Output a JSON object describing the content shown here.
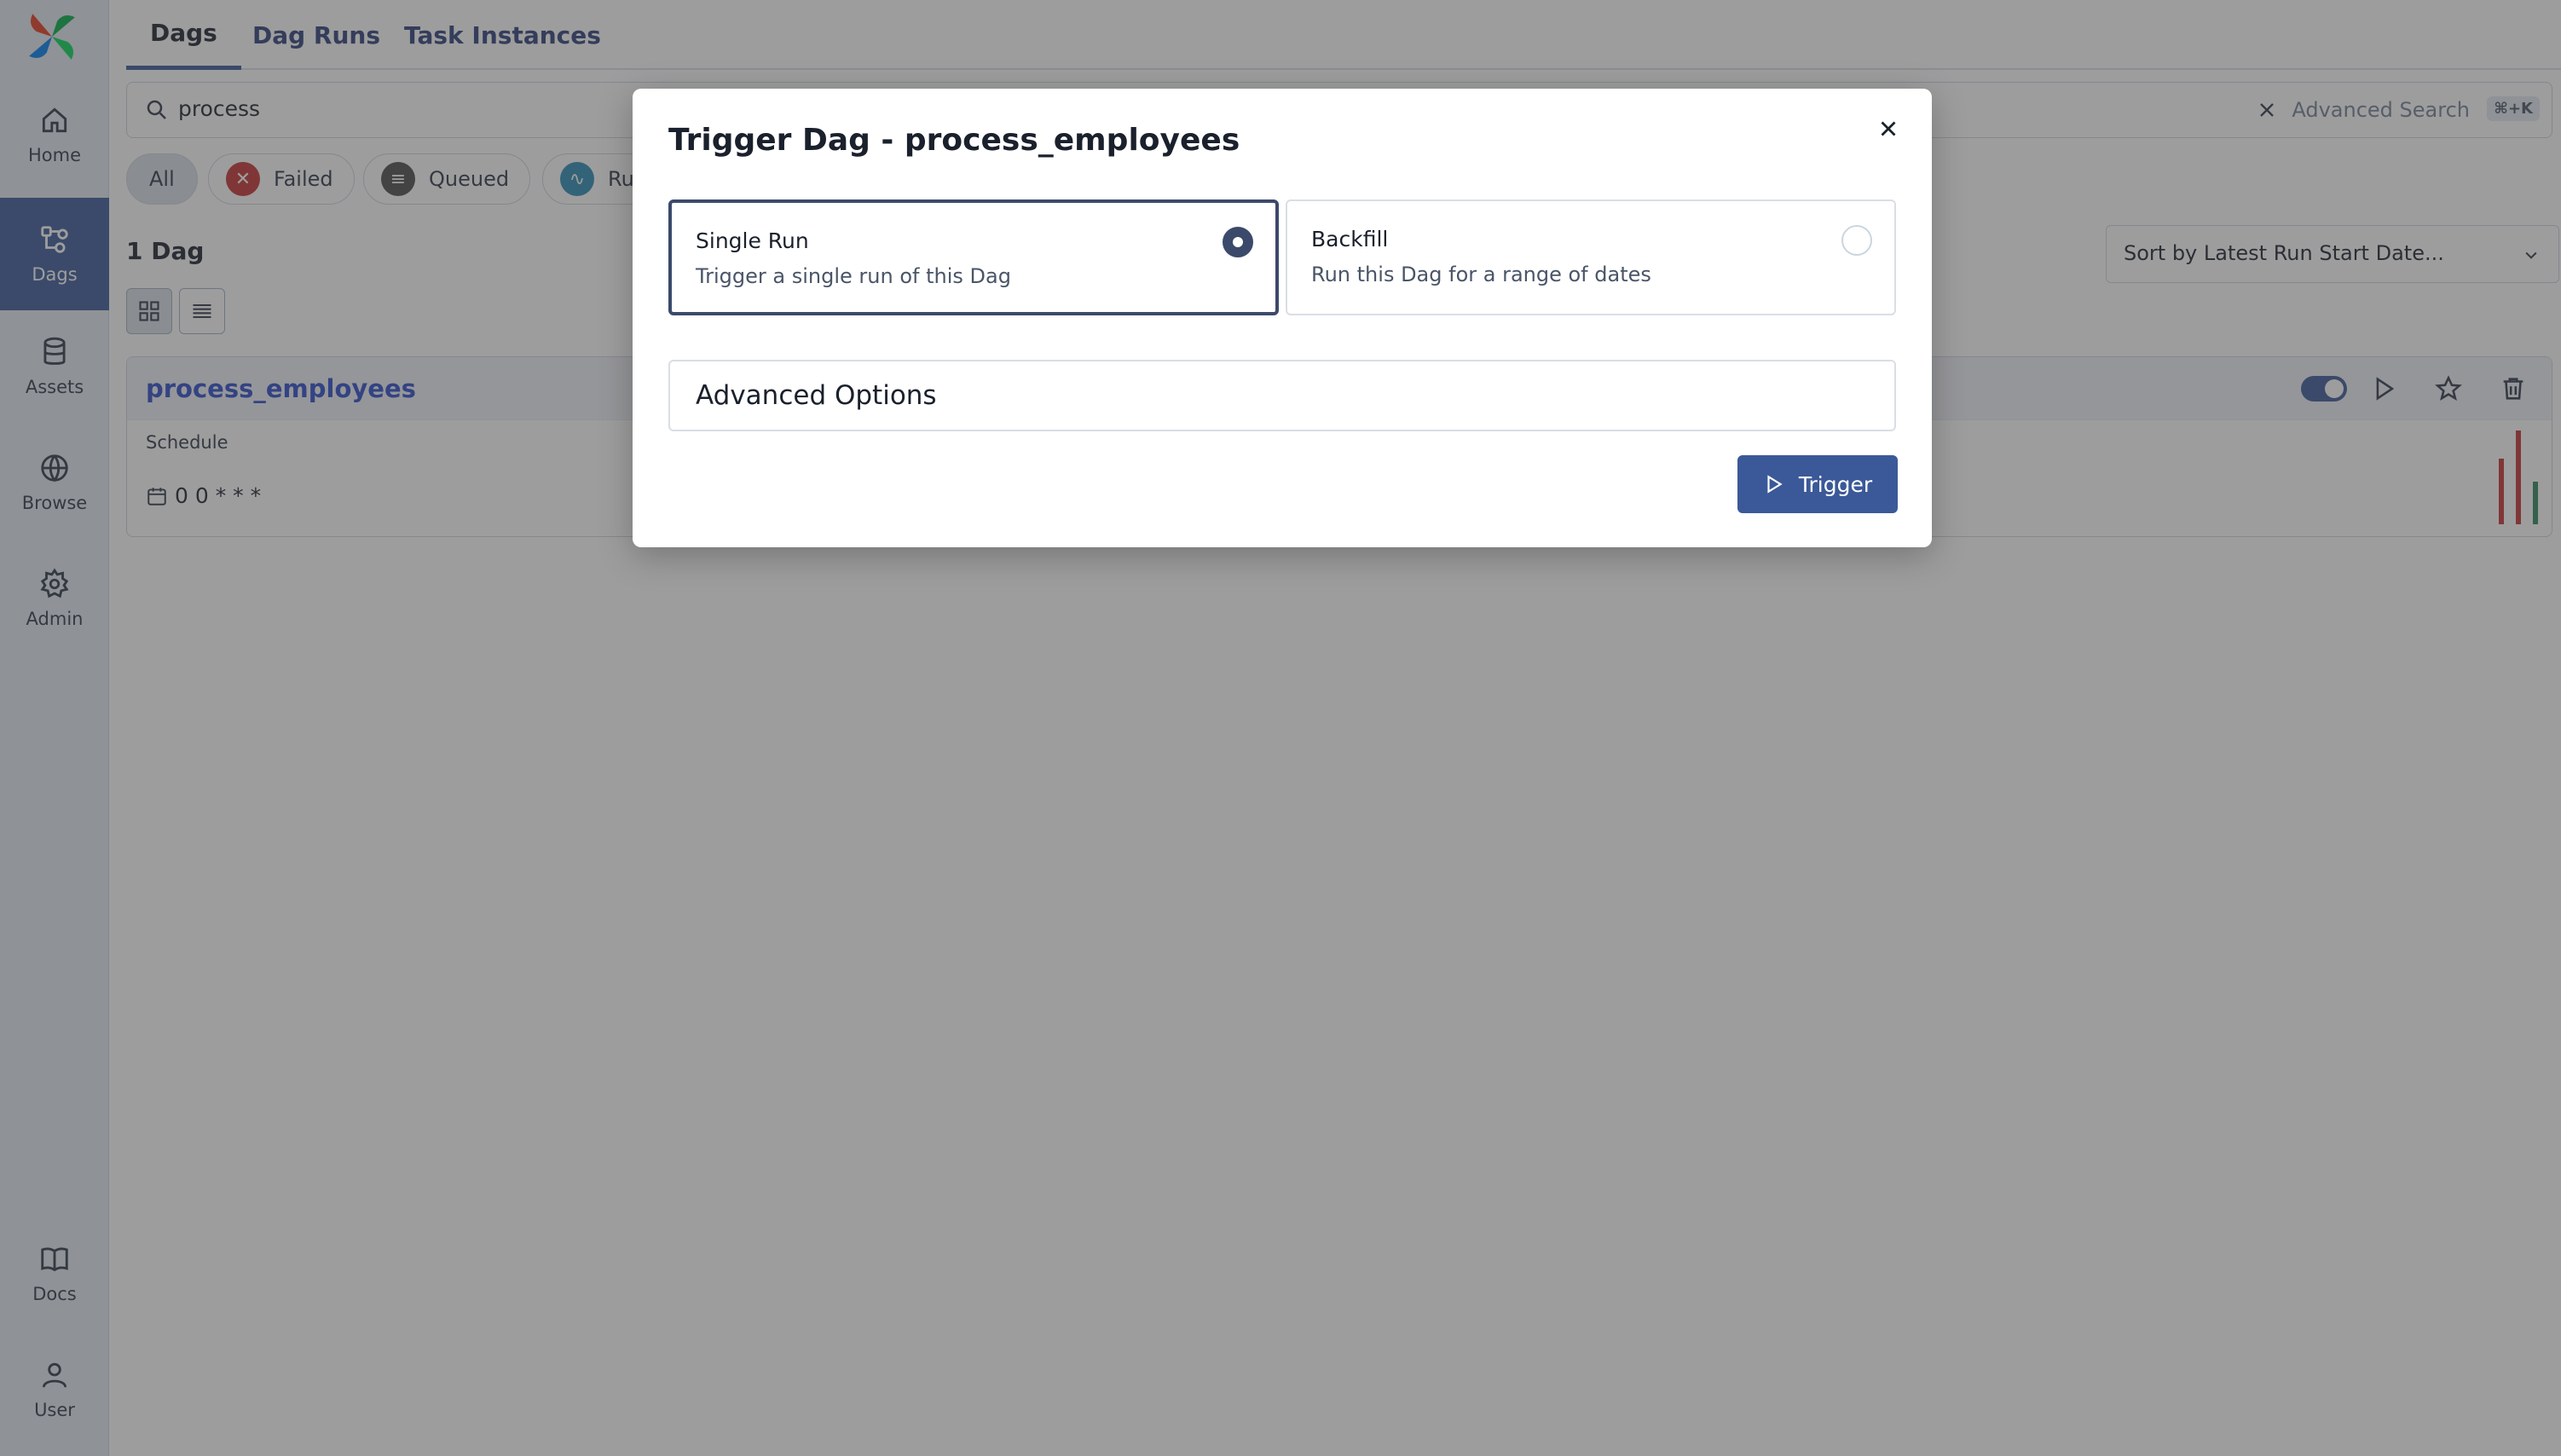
{
  "sidebar": {
    "items": [
      {
        "label": "Home",
        "icon": "home-icon"
      },
      {
        "label": "Dags",
        "icon": "dags-icon",
        "active": true
      },
      {
        "label": "Assets",
        "icon": "database-icon"
      },
      {
        "label": "Browse",
        "icon": "globe-icon"
      },
      {
        "label": "Admin",
        "icon": "gear-icon"
      },
      {
        "label": "Docs",
        "icon": "book-icon"
      },
      {
        "label": "User",
        "icon": "user-icon"
      }
    ]
  },
  "tabs": [
    {
      "label": "Dags",
      "active": true
    },
    {
      "label": "Dag Runs"
    },
    {
      "label": "Task Instances"
    }
  ],
  "search": {
    "value": "process",
    "advanced_label": "Advanced Search",
    "shortcut": "⌘+K"
  },
  "filters": {
    "all": "All",
    "failed": "Failed",
    "queued": "Queued",
    "running": "Ru"
  },
  "dag_count": "1 Dag",
  "sort": {
    "label": "Sort by Latest Run Start Date..."
  },
  "dag_card": {
    "name": "process_employees",
    "schedule_label": "Schedule",
    "schedule_value": "0 0 * * *",
    "enabled": true
  },
  "recent_runs": [
    {
      "status": "failed",
      "color": "#c53030",
      "height": 0.7
    },
    {
      "status": "failed",
      "color": "#c53030",
      "height": 1.0
    },
    {
      "status": "success",
      "color": "#2f855a",
      "height": 0.45
    }
  ],
  "modal": {
    "title": "Trigger Dag - process_employees",
    "options": [
      {
        "title": "Single Run",
        "description": "Trigger a single run of this Dag",
        "selected": true
      },
      {
        "title": "Backfill",
        "description": "Run this Dag for a range of dates",
        "selected": false
      }
    ],
    "advanced_options_label": "Advanced Options",
    "trigger_label": "Trigger"
  },
  "colors": {
    "accent": "#3b5998",
    "link": "#2b4acb",
    "failed": "#c53030",
    "queued": "#4a4a4a",
    "running": "#2b8ab5"
  }
}
